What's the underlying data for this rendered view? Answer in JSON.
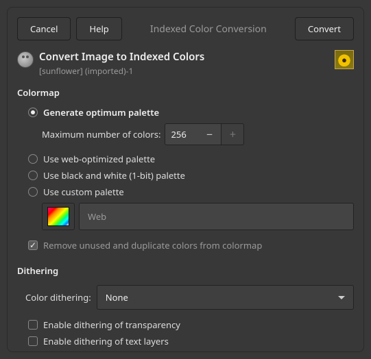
{
  "buttons": {
    "cancel": "Cancel",
    "help": "Help",
    "convert": "Convert"
  },
  "window_title": "Indexed Color Conversion",
  "header": {
    "title": "Convert Image to Indexed Colors",
    "subtitle": "[sunflower] (imported)-1"
  },
  "colormap": {
    "section": "Colormap",
    "generate": "Generate optimum palette",
    "max_label": "Maximum number of colors:",
    "max_value": "256",
    "web": "Use web-optimized palette",
    "bw": "Use black and white (1-bit) palette",
    "custom": "Use custom palette",
    "palette_name": "Web",
    "remove_dup": "Remove unused and duplicate colors from colormap"
  },
  "dithering": {
    "section": "Dithering",
    "label": "Color dithering:",
    "value": "None",
    "transparency": "Enable dithering of transparency",
    "textlayers": "Enable dithering of text layers"
  }
}
